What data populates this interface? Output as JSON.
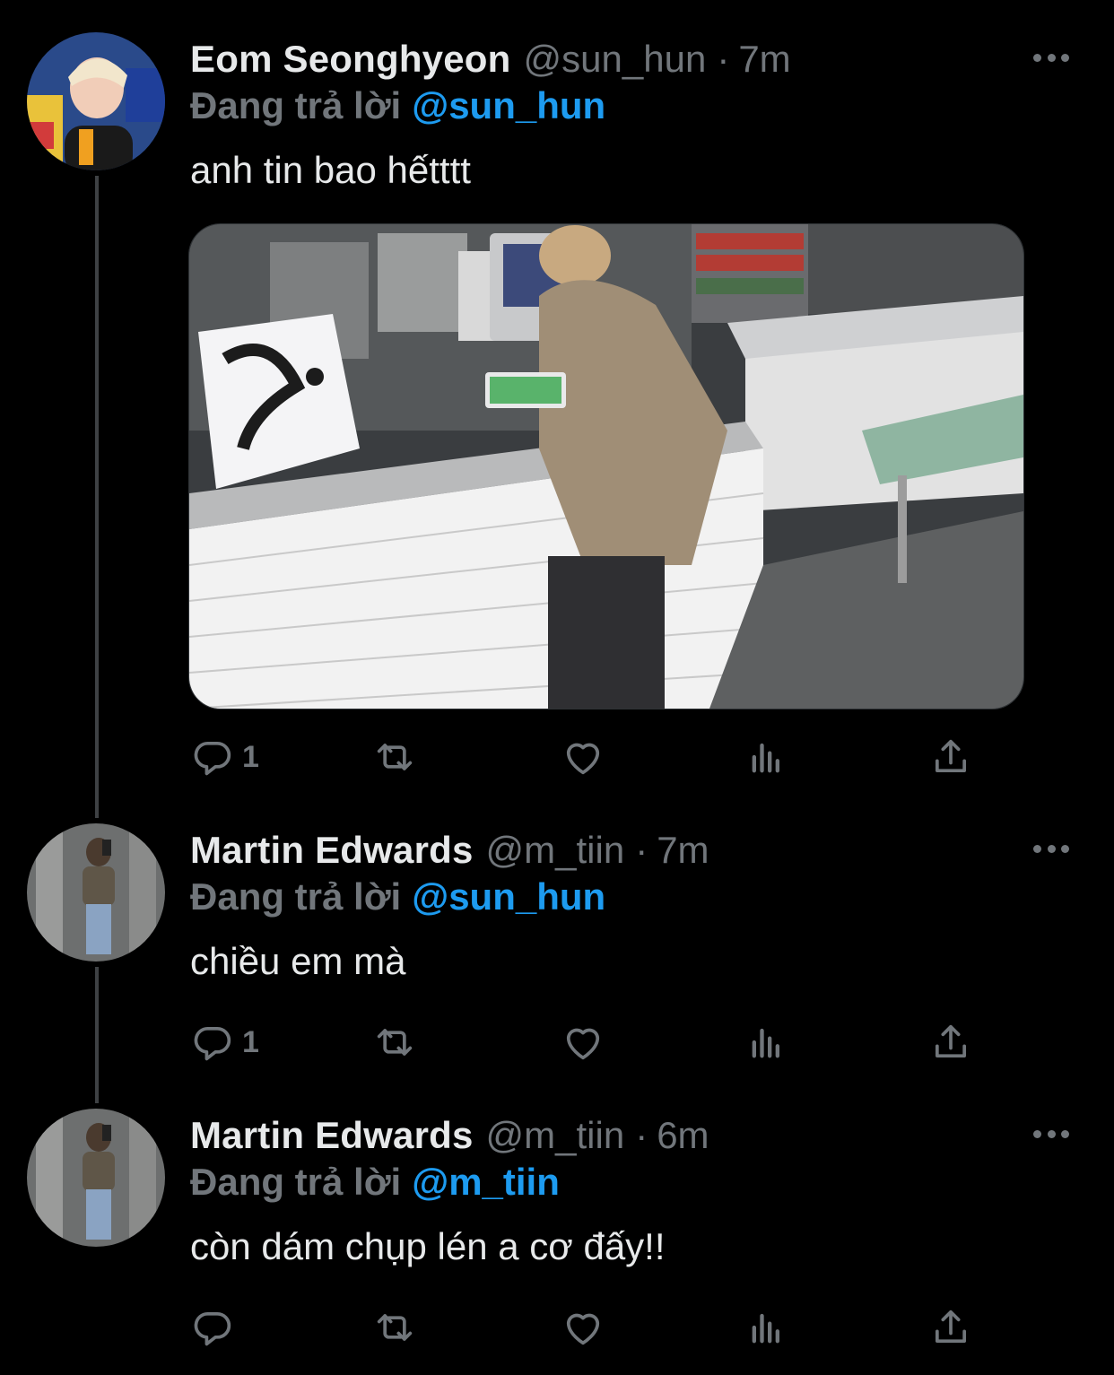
{
  "tweets": [
    {
      "name": "Eom Seonghyeon",
      "handle": "@sun_hun",
      "separator": "·",
      "time": "7m",
      "reply_prefix": "Đang trả lời",
      "reply_to": "@sun_hun",
      "text": "anh tin bao hếtttt",
      "reply_count": "1",
      "has_media": true
    },
    {
      "name": "Martin Edwards",
      "handle": "@m_tiin",
      "separator": "·",
      "time": "7m",
      "reply_prefix": "Đang trả lời",
      "reply_to": "@sun_hun",
      "text": "chiều em mà",
      "reply_count": "1",
      "has_media": false
    },
    {
      "name": "Martin Edwards",
      "handle": "@m_tiin",
      "separator": "·",
      "time": "6m",
      "reply_prefix": "Đang trả lời",
      "reply_to": "@m_tiin",
      "text": "còn dám chụp lén a cơ đấy!!",
      "reply_count": "",
      "has_media": false
    }
  ],
  "icons": {
    "reply": "reply-icon",
    "retweet": "retweet-icon",
    "like": "heart-icon",
    "views": "views-icon",
    "share": "share-icon",
    "more": "more-icon"
  },
  "colors": {
    "background": "#000000",
    "text": "#e7e9ea",
    "muted": "#71767b",
    "accent": "#1d9bf0",
    "thread_line": "#3e4144"
  }
}
